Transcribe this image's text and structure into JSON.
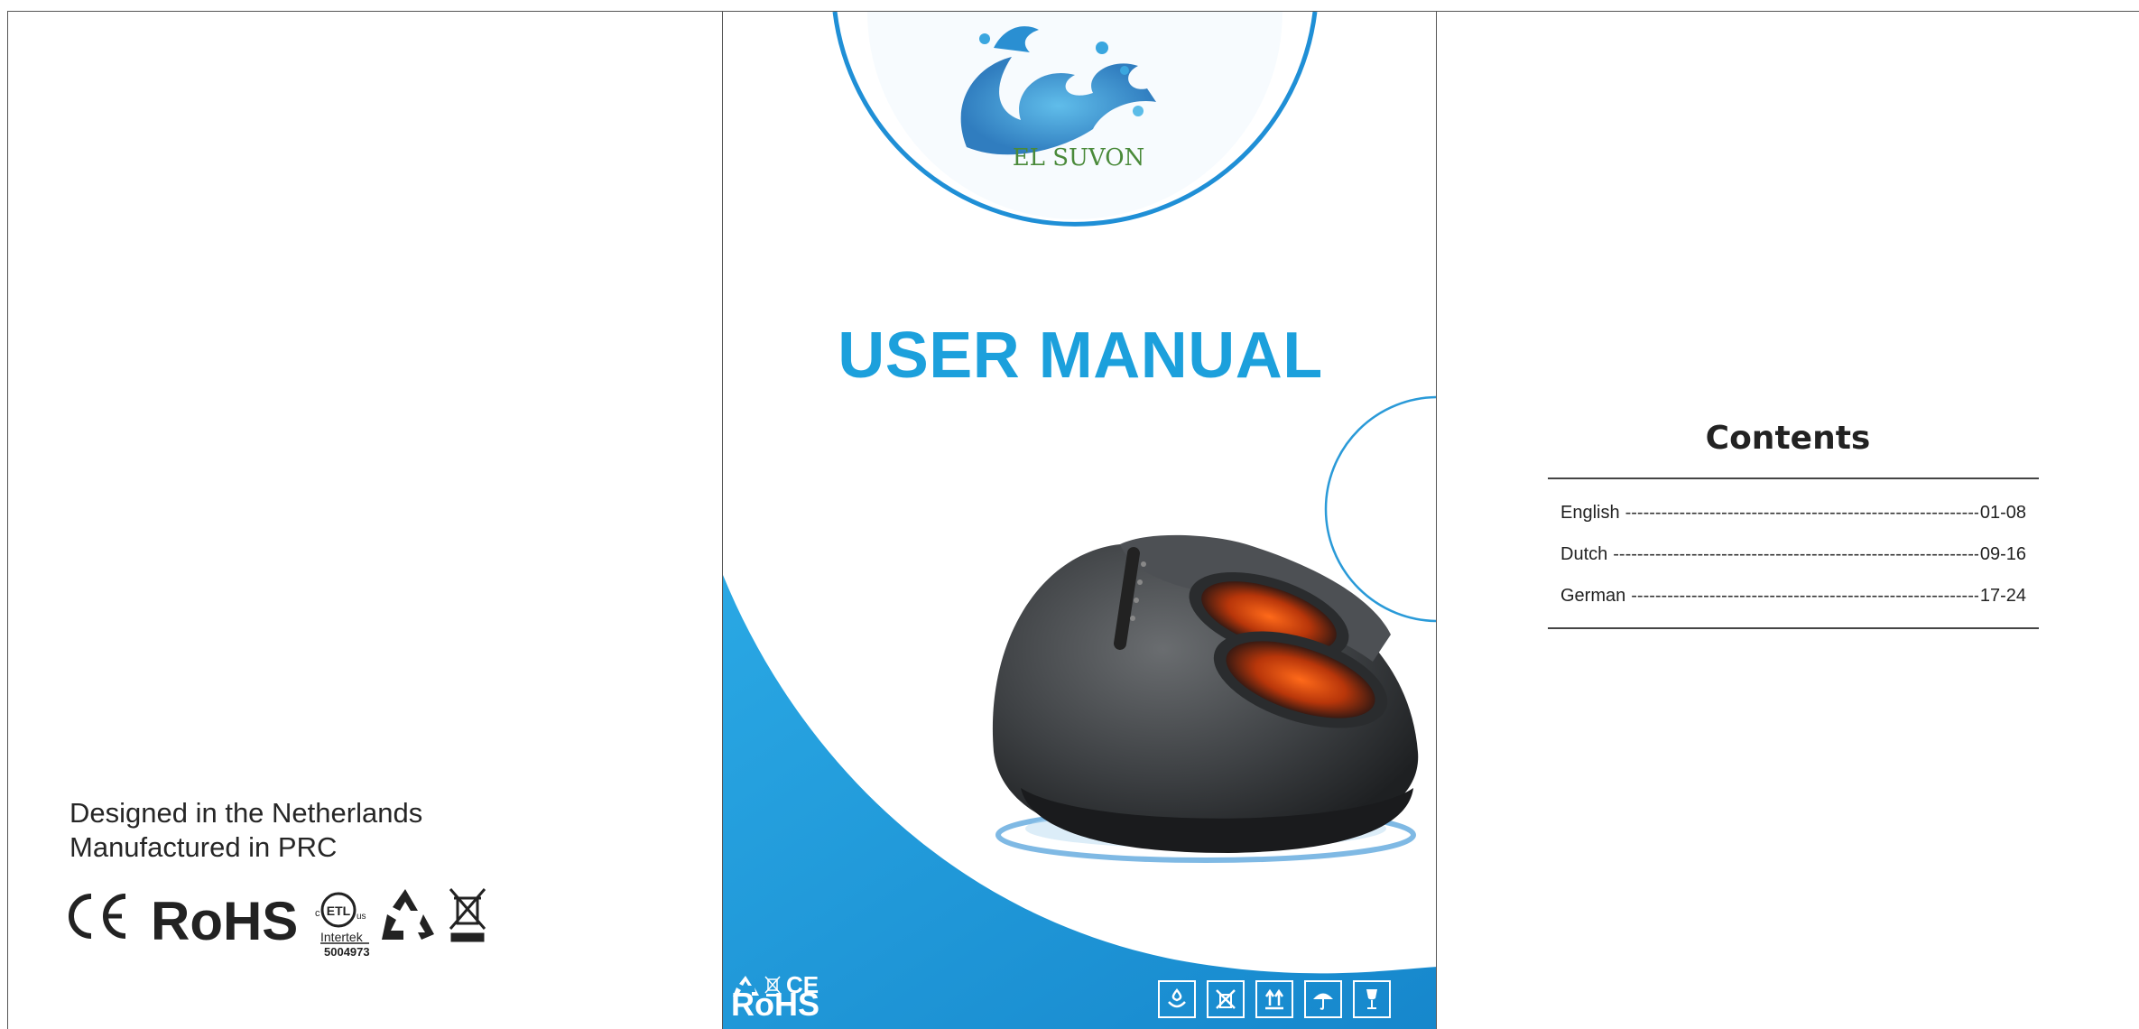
{
  "back_page": {
    "origin_line1": "Designed in the Netherlands",
    "origin_line2": "Manufactured in PRC",
    "certs": {
      "ce": "CE",
      "rohs": "RoHS",
      "etl_c": "c",
      "etl_mark": "ETL",
      "etl_us": "us",
      "etl_lab": "Intertek",
      "etl_number": "5004973"
    }
  },
  "cover": {
    "brand_logo_text": "EL SUVON",
    "title": "USER MANUAL",
    "bottom_left_ce": "CE",
    "bottom_left_rohs": "RoHS",
    "package_icons": [
      "keep-dry-icon",
      "do-not-stack-icon",
      "this-way-up-icon",
      "umbrella-icon",
      "fragile-icon"
    ],
    "colors": {
      "accent": "#1ca0dc",
      "dark_blue": "#1585c8"
    }
  },
  "contents_page": {
    "title": "Contents",
    "entries": [
      {
        "language": "English",
        "pages": "01-08"
      },
      {
        "language": "Dutch",
        "pages": "09-16"
      },
      {
        "language": "German",
        "pages": "17-24"
      }
    ]
  }
}
